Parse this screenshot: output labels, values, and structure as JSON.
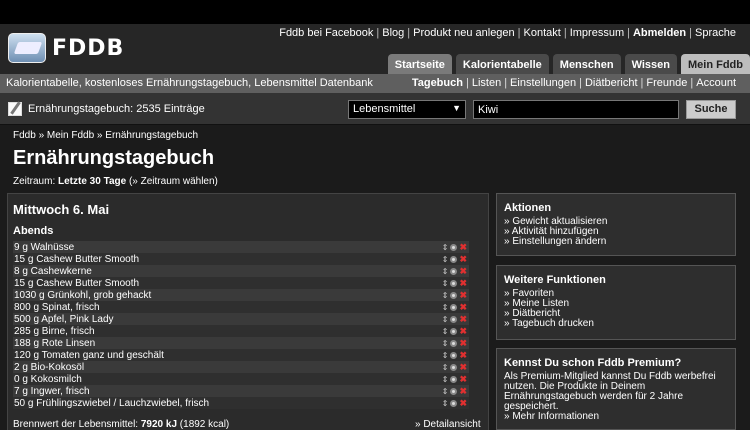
{
  "top_links": [
    "Fddb bei Facebook",
    "Blog",
    "Produkt neu anlegen",
    "Kontakt",
    "Impressum",
    "Abmelden",
    "Sprache"
  ],
  "logo_text": "FDDB",
  "tabs": [
    "Startseite",
    "Kalorientabelle",
    "Menschen",
    "Wissen",
    "Mein Fddb"
  ],
  "subbar_left": "Kalorientabelle, kostenloses Ernährungstagebuch, Lebensmittel Datenbank",
  "subnav": [
    "Tagebuch",
    "Listen",
    "Einstellungen",
    "Diätbericht",
    "Freunde",
    "Account"
  ],
  "diary_count": "Ernährungstagebuch: 2535 Einträge",
  "search": {
    "category": "Lebensmittel",
    "query": "Kiwi",
    "button": "Suche"
  },
  "breadcrumb": "Fddb » Mein Fddb » Ernährungstagebuch",
  "title": "Ernährungstagebuch",
  "period": {
    "label": "Zeitraum:",
    "value": "Letzte 30 Tage",
    "link": "(» Zeitraum wählen)"
  },
  "day": "Mittwoch 6. Mai",
  "meal": "Abends",
  "entries": [
    "9 g Walnüsse",
    "15 g Cashew Butter Smooth",
    "8 g Cashewkerne",
    "15 g Cashew Butter Smooth",
    "1030 g Grünkohl, grob gehackt",
    "800 g Spinat, frisch",
    "500 g Apfel, Pink Lady",
    "285 g Birne, frisch",
    "188 g Rote Linsen",
    "120 g Tomaten ganz und geschält",
    "2 g Bio-Kokosöl",
    "0 g Kokosmilch",
    "7 g Ingwer, frisch",
    "50 g Frühlingszwiebel / Lauchzwiebel, frisch"
  ],
  "footer": {
    "label": "Brennwert der Lebensmittel:",
    "value": "7920 kJ",
    "extra": "(1892 kcal)",
    "detail": "» Detailansicht"
  },
  "actions": {
    "title": "Aktionen",
    "items": [
      "» Gewicht aktualisieren",
      "» Aktivität hinzufügen",
      "» Einstellungen ändern"
    ]
  },
  "more": {
    "title": "Weitere Funktionen",
    "items": [
      "» Favoriten",
      "» Meine Listen",
      "» Diätbericht",
      "» Tagebuch drucken"
    ]
  },
  "premium": {
    "title": "Kennst Du schon Fddb Premium?",
    "text": "Als Premium-Mitglied kannst Du Fddb werbefrei nutzen. Die Produkte in Deinem Ernährungstagebuch werden für 2 Jahre gespeichert.",
    "link": "» Mehr Informationen"
  },
  "colors": {
    "delete": "#e03030",
    "background": "#1b1b1b"
  }
}
